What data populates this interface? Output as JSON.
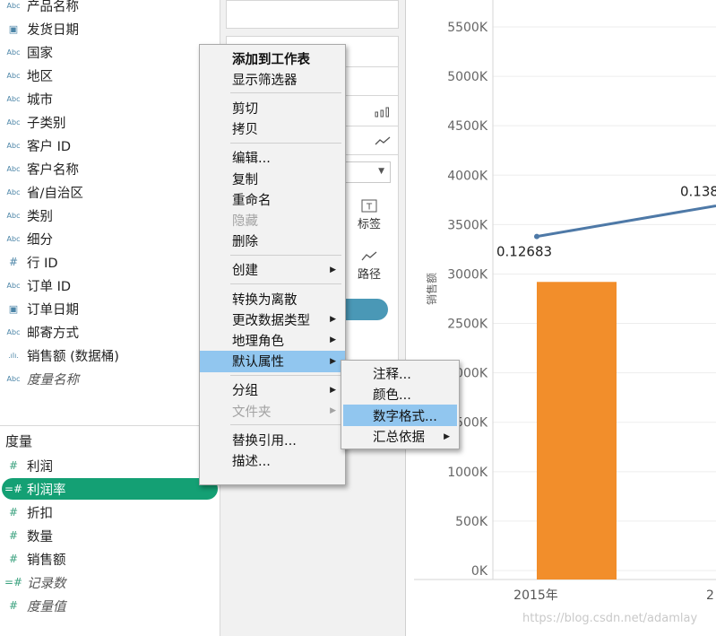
{
  "dimensions": [
    {
      "icon": "Abc",
      "label": "产品名称",
      "italic": false
    },
    {
      "icon": "cal",
      "label": "发货日期",
      "italic": false
    },
    {
      "icon": "Abc",
      "label": "国家",
      "italic": false
    },
    {
      "icon": "Abc",
      "label": "地区",
      "italic": false
    },
    {
      "icon": "Abc",
      "label": "城市",
      "italic": false
    },
    {
      "icon": "Abc",
      "label": "子类别",
      "italic": false
    },
    {
      "icon": "Abc",
      "label": "客户 ID",
      "italic": false
    },
    {
      "icon": "Abc",
      "label": "客户名称",
      "italic": false
    },
    {
      "icon": "Abc",
      "label": "省/自治区",
      "italic": false
    },
    {
      "icon": "Abc",
      "label": "类别",
      "italic": false
    },
    {
      "icon": "Abc",
      "label": "细分",
      "italic": false
    },
    {
      "icon": "#",
      "label": "行 ID",
      "italic": false
    },
    {
      "icon": "Abc",
      "label": "订单 ID",
      "italic": false
    },
    {
      "icon": "cal",
      "label": "订单日期",
      "italic": false
    },
    {
      "icon": "Abc",
      "label": "邮寄方式",
      "italic": false
    },
    {
      "icon": ".ılı.",
      "label": "销售额 (数据桶)",
      "italic": false
    },
    {
      "icon": "Abc",
      "label": "度量名称",
      "italic": true
    }
  ],
  "measures_title": "度量",
  "measures": [
    {
      "icon": "#",
      "label": "利润",
      "italic": false,
      "selected": false
    },
    {
      "icon": "=#",
      "label": "利润率",
      "italic": false,
      "selected": true
    },
    {
      "icon": "#",
      "label": "折扣",
      "italic": false,
      "selected": false
    },
    {
      "icon": "#",
      "label": "数量",
      "italic": false,
      "selected": false
    },
    {
      "icon": "#",
      "label": "销售额",
      "italic": false,
      "selected": false
    },
    {
      "icon": "=#",
      "label": "记录数",
      "italic": true,
      "selected": false
    },
    {
      "icon": "#",
      "label": "度量值",
      "italic": true,
      "selected": false
    }
  ],
  "marks": {
    "label_tile": "标签",
    "path_tile": "路径"
  },
  "context_menu": [
    {
      "label": "添加到工作表",
      "bold": true,
      "disabled": false,
      "submenu": false,
      "highlighted": false,
      "sep_after": false
    },
    {
      "label": "显示筛选器",
      "bold": false,
      "disabled": false,
      "submenu": false,
      "highlighted": false,
      "sep_after": true
    },
    {
      "label": "剪切",
      "bold": false,
      "disabled": false,
      "submenu": false,
      "highlighted": false,
      "sep_after": false
    },
    {
      "label": "拷贝",
      "bold": false,
      "disabled": false,
      "submenu": false,
      "highlighted": false,
      "sep_after": true
    },
    {
      "label": "编辑...",
      "bold": false,
      "disabled": false,
      "submenu": false,
      "highlighted": false,
      "sep_after": false
    },
    {
      "label": "复制",
      "bold": false,
      "disabled": false,
      "submenu": false,
      "highlighted": false,
      "sep_after": false
    },
    {
      "label": "重命名",
      "bold": false,
      "disabled": false,
      "submenu": false,
      "highlighted": false,
      "sep_after": false
    },
    {
      "label": "隐藏",
      "bold": false,
      "disabled": true,
      "submenu": false,
      "highlighted": false,
      "sep_after": false
    },
    {
      "label": "删除",
      "bold": false,
      "disabled": false,
      "submenu": false,
      "highlighted": false,
      "sep_after": true
    },
    {
      "label": "创建",
      "bold": false,
      "disabled": false,
      "submenu": true,
      "highlighted": false,
      "sep_after": true
    },
    {
      "label": "转换为离散",
      "bold": false,
      "disabled": false,
      "submenu": false,
      "highlighted": false,
      "sep_after": false
    },
    {
      "label": "更改数据类型",
      "bold": false,
      "disabled": false,
      "submenu": true,
      "highlighted": false,
      "sep_after": false
    },
    {
      "label": "地理角色",
      "bold": false,
      "disabled": false,
      "submenu": true,
      "highlighted": false,
      "sep_after": false
    },
    {
      "label": "默认属性",
      "bold": false,
      "disabled": false,
      "submenu": true,
      "highlighted": true,
      "sep_after": true
    },
    {
      "label": "分组",
      "bold": false,
      "disabled": false,
      "submenu": true,
      "highlighted": false,
      "sep_after": false
    },
    {
      "label": "文件夹",
      "bold": false,
      "disabled": true,
      "submenu": true,
      "highlighted": false,
      "sep_after": true
    },
    {
      "label": "替换引用...",
      "bold": false,
      "disabled": false,
      "submenu": false,
      "highlighted": false,
      "sep_after": false
    },
    {
      "label": "描述...",
      "bold": false,
      "disabled": false,
      "submenu": false,
      "highlighted": false,
      "sep_after": false
    }
  ],
  "submenu": [
    {
      "label": "注释...",
      "submenu": false,
      "highlighted": false
    },
    {
      "label": "颜色...",
      "submenu": false,
      "highlighted": false
    },
    {
      "label": "数字格式...",
      "submenu": false,
      "highlighted": true
    },
    {
      "label": "汇总依据",
      "submenu": true,
      "highlighted": false
    }
  ],
  "colors": {
    "selected_pill": "#14a074",
    "menu_highlight": "#91c6ef",
    "bar": "#f28e2b",
    "line": "#4e79a7"
  },
  "chart_data": {
    "type": "bar",
    "ylabel": "销售额",
    "y_ticks": [
      "0K",
      "500K",
      "1000K",
      "1500K",
      "2000K",
      "2500K",
      "3000K",
      "3500K",
      "4000K",
      "4500K",
      "5000K",
      "5500K"
    ],
    "ylim": [
      0,
      5700000
    ],
    "categories": [
      "2015年",
      "2"
    ],
    "bar_values": [
      2920000
    ],
    "line": {
      "values": [
        3380000,
        3690000
      ],
      "labels": [
        "0.12683",
        "0.138"
      ]
    }
  },
  "watermark": "https://blog.csdn.net/adamlay"
}
